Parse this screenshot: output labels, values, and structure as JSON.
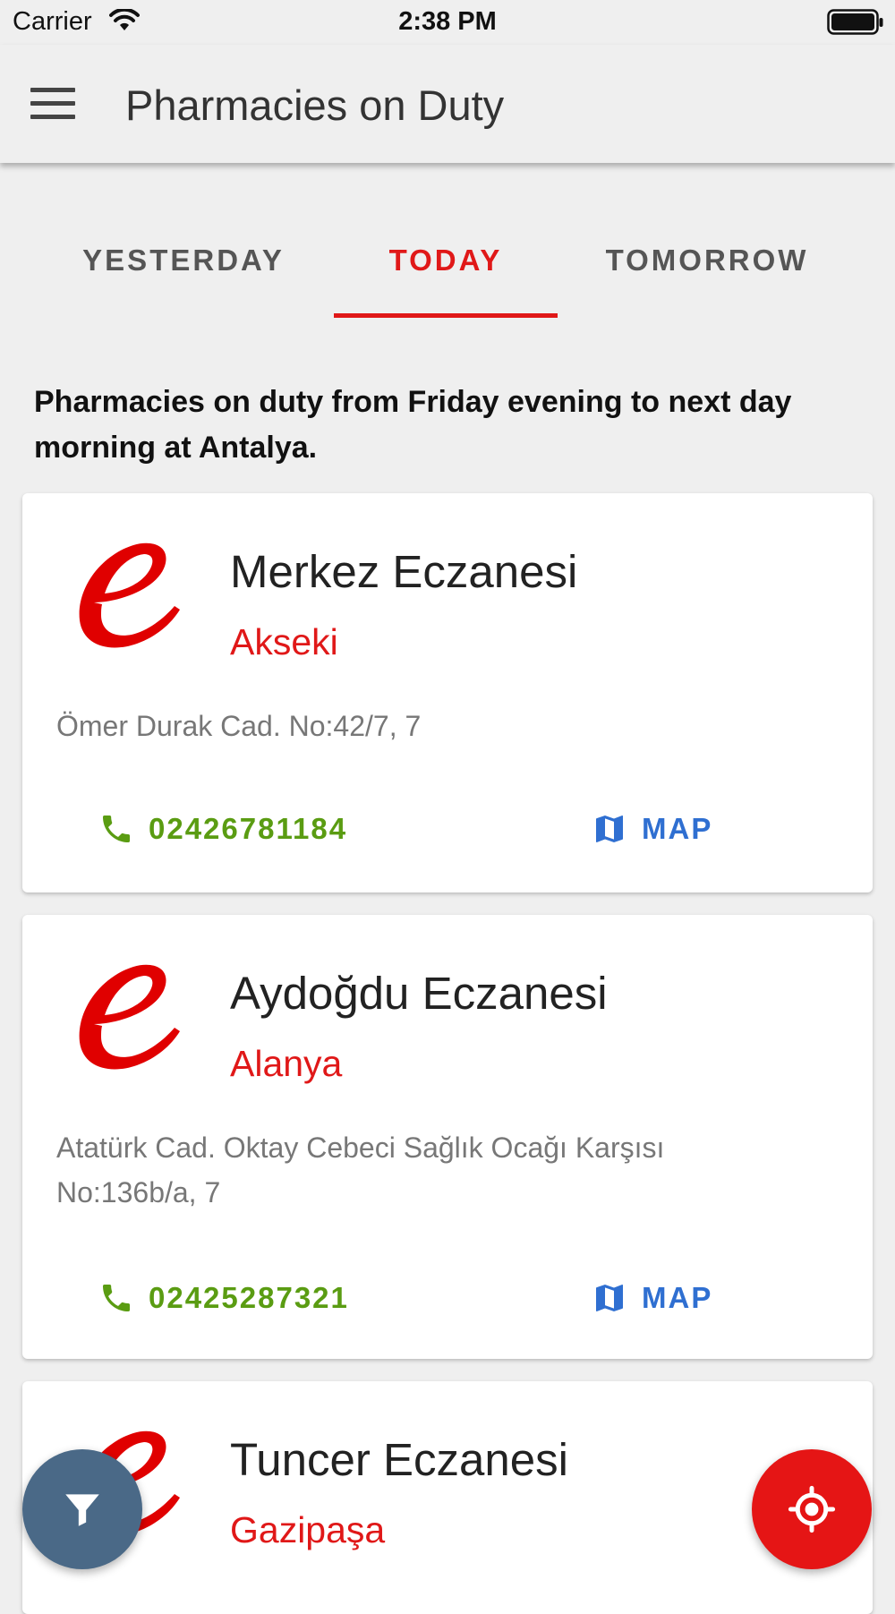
{
  "status_bar": {
    "carrier": "Carrier",
    "time": "2:38 PM"
  },
  "app_bar": {
    "title": "Pharmacies on Duty",
    "menu_icon": "hamburger-menu-icon"
  },
  "tabs": [
    {
      "label": "YESTERDAY",
      "selected": false
    },
    {
      "label": "TODAY",
      "selected": true
    },
    {
      "label": "TOMORROW",
      "selected": false
    }
  ],
  "intro": "Pharmacies on duty from Friday evening to next day morning at Antalya.",
  "pharmacies": [
    {
      "name": "Merkez Eczanesi",
      "district": "Akseki",
      "address": "Ömer Durak Cad. No:42/7, 7",
      "phone": "02426781184",
      "map_label": "MAP"
    },
    {
      "name": "Aydoğdu Eczanesi",
      "district": "Alanya",
      "address": "Atatürk Cad. Oktay Cebeci Sağlık Ocağı Karşısı No:136b/a, 7",
      "phone": "02425287321",
      "map_label": "MAP"
    },
    {
      "name": "Tuncer Eczanesi",
      "district": "Gazipaşa"
    }
  ],
  "colors": {
    "accent_red": "#e01818",
    "phone_green": "#5a9c12",
    "map_blue": "#2f6fd1",
    "filter_fab": "#4a6987",
    "locate_fab": "#e51515"
  },
  "fabs": {
    "filter_icon": "filter-icon",
    "locate_icon": "my-location-icon"
  }
}
